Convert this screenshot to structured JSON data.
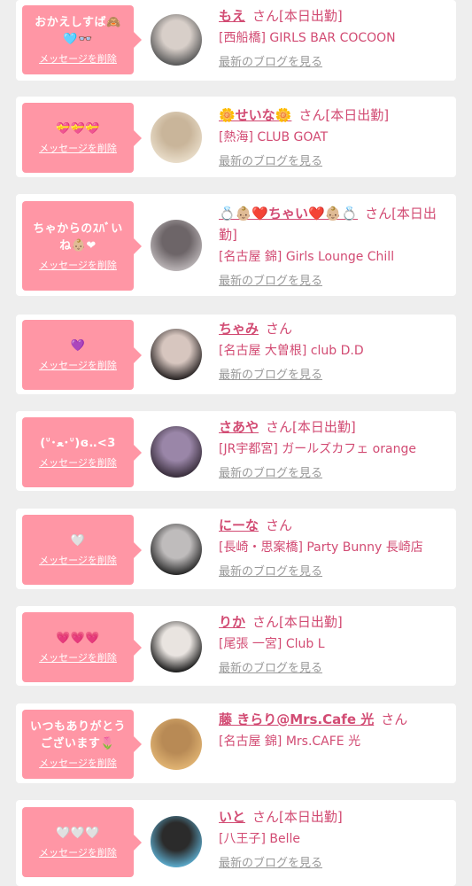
{
  "accent_color": "#ff96a5",
  "name_color": "#d24b73",
  "messages": [
    {
      "message": "おかえしすば🙈\n🩵👓",
      "delete_label": "メッセージを削除",
      "name": "もえ",
      "suffix": "さん[本日出勤]",
      "shop": "[西船橋] GIRLS BAR COCOON",
      "blog_link": "最新のブログを見る",
      "avatar_colors": [
        "#5a5a5a",
        "#d8cfc9"
      ]
    },
    {
      "message": "💝💝💝",
      "delete_label": "メッセージを削除",
      "name": "🌼せいな🌼",
      "suffix": "さん[本日出勤]",
      "shop": "[熱海] CLUB GOAT",
      "blog_link": "最新のブログを見る",
      "avatar_colors": [
        "#e8dcc8",
        "#c9b59a"
      ]
    },
    {
      "message": "ちゃからのｽﾊﾞい\nね👶🏼❤",
      "delete_label": "メッセージを削除",
      "name": "💍👶🏼❤️ちゃい❤️👶🏼💍",
      "suffix": "さん[本日出勤]",
      "shop": "[名古屋 錦] Girls Lounge Chill",
      "blog_link": "最新のブログを見る",
      "avatar_colors": [
        "#b8b2b4",
        "#6d6568"
      ]
    },
    {
      "message": "💜",
      "delete_label": "メッセージを削除",
      "name": "ちゃみ",
      "suffix": "さん",
      "shop": "[名古屋 大曽根] club D.D",
      "blog_link": "最新のブログを見る",
      "avatar_colors": [
        "#2b2626",
        "#d7c6bf"
      ]
    },
    {
      "message": "(ᐡ･ﻌ･ᐡ)ɞ‥<3",
      "delete_label": "メッセージを削除",
      "name": "さあや",
      "suffix": "さん[本日出勤]",
      "shop": "[JR宇都宮] ガールズカフェ orange",
      "blog_link": "最新のブログを見る",
      "avatar_colors": [
        "#3a2f3d",
        "#9a86a8"
      ]
    },
    {
      "message": "🤍",
      "delete_label": "メッセージを削除",
      "name": "にーな",
      "suffix": "さん",
      "shop": "[長崎・思案橋] Party Bunny 長崎店",
      "blog_link": "最新のブログを見る",
      "avatar_colors": [
        "#2a2a2a",
        "#bfbcbc"
      ]
    },
    {
      "message": "💗💗💗",
      "delete_label": "メッセージを削除",
      "name": "りか",
      "suffix": "さん[本日出勤]",
      "shop": "[尾張 一宮] Club L",
      "blog_link": "最新のブログを見る",
      "avatar_colors": [
        "#1f1f1f",
        "#e9e4e0"
      ]
    },
    {
      "message": "いつもありがとう\nございます🌷",
      "delete_label": "メッセージを削除",
      "name": "藤 きらり@Mrs.Cafe 光",
      "suffix": "さん",
      "shop": "[名古屋 錦] Mrs.CAFE 光",
      "blog_link": "",
      "avatar_colors": [
        "#e0b372",
        "#b88a55"
      ]
    },
    {
      "message": "🤍🤍🤍",
      "delete_label": "メッセージを削除",
      "name": "いと",
      "suffix": "さん[本日出勤]",
      "shop": "[八王子] Belle",
      "blog_link": "最新のブログを見る",
      "avatar_colors": [
        "#5aa7c8",
        "#2b2b2b"
      ]
    }
  ]
}
